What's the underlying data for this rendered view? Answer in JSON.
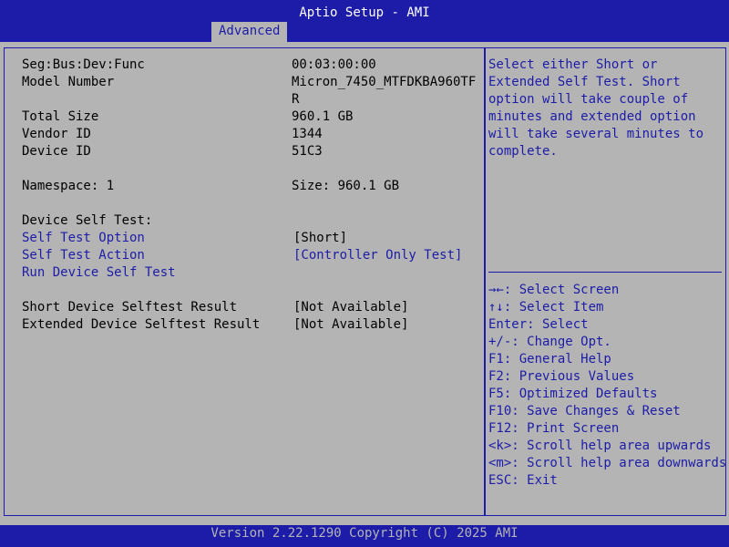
{
  "header": {
    "title": "Aptio Setup - AMI",
    "tab": "Advanced"
  },
  "info": {
    "seg_label": "Seg:Bus:Dev:Func",
    "seg_value": "00:03:00:00",
    "model_label": "Model Number",
    "model_value_line1": "Micron_7450_MTFDKBA960TF",
    "model_value_line2": "R",
    "size_label": "Total Size",
    "size_value": "960.1 GB",
    "vendor_label": "Vendor ID",
    "vendor_value": "1344",
    "device_label": "Device ID",
    "device_value": "51C3",
    "namespace_label": "Namespace: 1",
    "namespace_size": "Size: 960.1 GB",
    "self_test_heading": "Device Self Test:"
  },
  "options": {
    "test_option_label": "Self Test Option",
    "test_option_value": "[Short]",
    "test_action_label": "Self Test Action",
    "test_action_value": "[Controller Only Test]",
    "run_label": "Run Device Self Test"
  },
  "results": {
    "short_label": "Short Device Selftest Result",
    "short_value": "[Not Available]",
    "extended_label": "Extended Device Selftest Result",
    "extended_value": "[Not Available]"
  },
  "help": {
    "text": "Select either Short or\nExtended Self Test. Short\noption will take couple of\nminutes and extended option\nwill take several minutes to\ncomplete."
  },
  "keys": [
    "→←: Select Screen",
    "↑↓: Select Item",
    "Enter: Select",
    "+/-: Change Opt.",
    "F1: General Help",
    "F2: Previous Values",
    "F5: Optimized Defaults",
    "F10: Save Changes & Reset",
    "F12: Print Screen",
    "<k>: Scroll help area upwards",
    "<m>: Scroll help area downwards",
    "ESC: Exit"
  ],
  "footer": {
    "version": "Version 2.22.1290 Copyright (C) 2025 AMI"
  },
  "colors": {
    "bar": "#1c1ca8",
    "background": "#b4b4b4",
    "text": "#000000",
    "selectable": "#1c1ca8"
  }
}
